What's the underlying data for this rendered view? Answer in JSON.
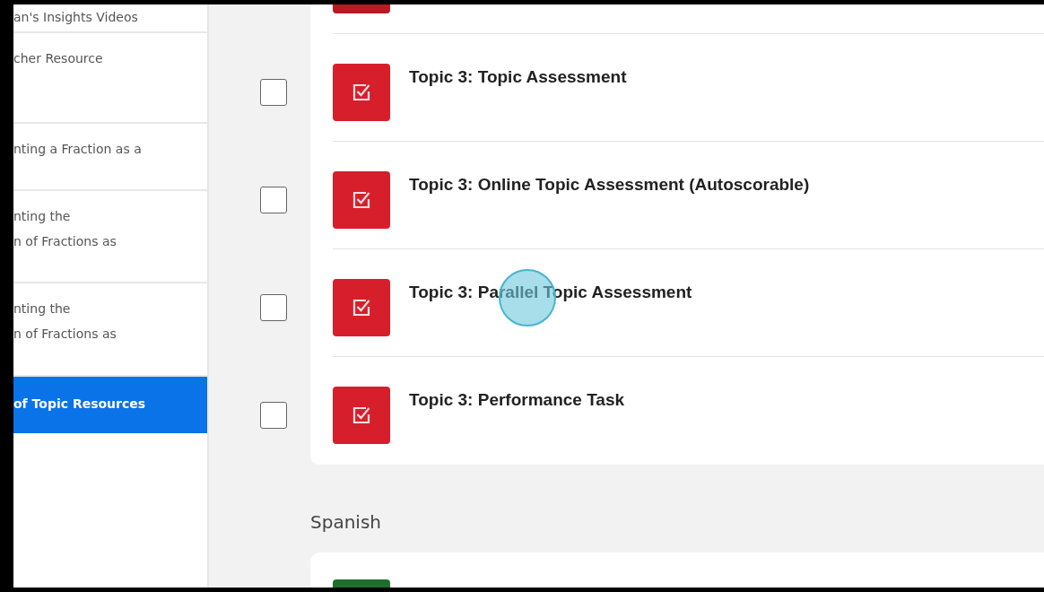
{
  "sidebar": {
    "items": [
      {
        "label": "an's Insights Videos",
        "selected": false
      },
      {
        "label": "cher Resource",
        "selected": false
      },
      {
        "label": "nting a Fraction as a",
        "selected": false
      },
      {
        "label": "nting the\nn of Fractions as",
        "selected": false
      },
      {
        "label": "nting the\nn of Fractions as",
        "selected": false
      },
      {
        "label": "of Topic Resources",
        "selected": true
      }
    ]
  },
  "assessments": {
    "items": [
      {
        "kind": "assessment",
        "title": "Topic 3: Topic Assessment",
        "checked": false
      },
      {
        "kind": "assessment",
        "title": "Topic 3: Online Topic Assessment (Autoscorable)",
        "checked": false
      },
      {
        "kind": "assessment",
        "title": "Topic 3: Parallel Topic Assessment",
        "checked": false
      },
      {
        "kind": "assessment",
        "title": "Topic 3: Performance Task",
        "checked": false
      }
    ]
  },
  "spanish": {
    "heading": "Spanish",
    "items": [
      {
        "kind": "spanish"
      }
    ]
  }
}
